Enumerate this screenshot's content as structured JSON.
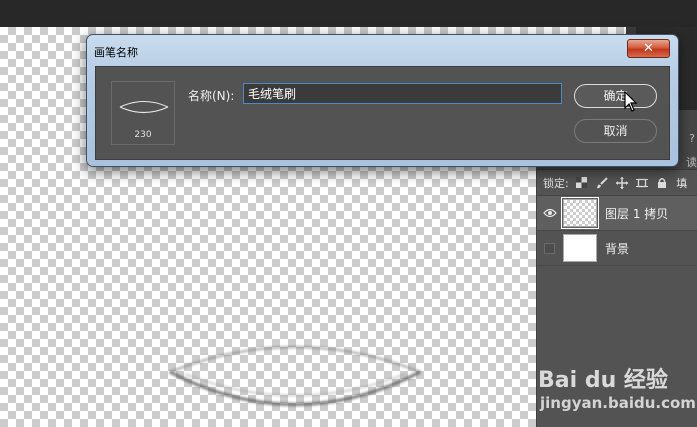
{
  "dialog": {
    "title": "画笔名称",
    "close_label": "✕",
    "preview_size": "230",
    "name_label": "名称(N):",
    "name_value": "毛绒笔刷",
    "ok_label": "确定",
    "cancel_label": "取消"
  },
  "layers_panel": {
    "lock_label": "锁定:",
    "layers": [
      {
        "name": "图层 1 拷贝",
        "visible": true,
        "selected": true,
        "thumbnail": "transparent"
      },
      {
        "name": "背景",
        "visible": false,
        "selected": false,
        "thumbnail": "white"
      }
    ]
  },
  "watermark": {
    "line1": "Bai du 经验",
    "line2": "jingyan.baidu.com"
  },
  "icons": {
    "eye": "eye-icon",
    "lock_transparent": "checker-lock-icon",
    "lock_paint": "brush-lock-icon",
    "lock_move": "move-lock-icon",
    "lock_artboard": "artboard-lock-icon",
    "lock_all": "padlock-icon"
  },
  "colors": {
    "input_border": "#4d88c7",
    "close_button": "#c8452a",
    "panel_bg": "#535353"
  }
}
